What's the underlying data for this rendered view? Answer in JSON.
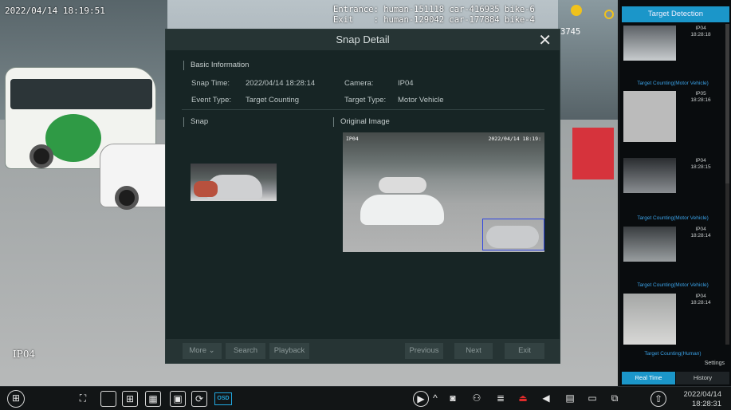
{
  "camera_view": {
    "timestamp": "2022/04/14 18:19:51",
    "counting_line1": "Entrance: human-151118 car-416935 bike-6",
    "counting_line2": "Exit    : human-129042 car-177884 bike-4",
    "counting_extra": "3745",
    "camera_name": "IP04"
  },
  "dialog": {
    "title": "Snap Detail",
    "close_glyph": "✕",
    "basic_info_heading": "Basic Information",
    "snap_time_label": "Snap Time:",
    "snap_time_value": "2022/04/14 18:28:14",
    "camera_label": "Camera:",
    "camera_value": "IP04",
    "event_type_label": "Event Type:",
    "event_type_value": "Target Counting",
    "target_type_label": "Target Type:",
    "target_type_value": "Motor Vehicle",
    "snap_heading": "Snap",
    "original_heading": "Original Image",
    "original_overlay_camera": "IP04",
    "original_overlay_time": "2022/04/14 18:19:",
    "buttons": {
      "more": "More",
      "more_arrow": "⌄",
      "search": "Search",
      "playback": "Playback",
      "previous": "Previous",
      "next": "Next",
      "exit": "Exit"
    }
  },
  "right_panel": {
    "title": "Target Detection",
    "cards": [
      {
        "camera": "IP04",
        "time": "18:28:18",
        "caption": "Target Counting(Motor Vehicle)"
      },
      {
        "camera": "IP05",
        "time": "18:28:16",
        "caption": ""
      },
      {
        "camera": "IP04",
        "time": "18:28:15",
        "caption": "Target Counting(Motor Vehicle)"
      },
      {
        "camera": "IP04",
        "time": "18:28:14",
        "caption": "Target Counting(Motor Vehicle)"
      },
      {
        "camera": "IP04",
        "time": "18:28:14",
        "caption": "Target Counting(Human)"
      }
    ],
    "settings": "Settings",
    "tab_realtime": "Real Time",
    "tab_history": "History"
  },
  "toolbar": {
    "osd_label": "OSD",
    "date": "2022/04/14",
    "time": "18:28:31"
  },
  "colors": {
    "accent": "#1b96c9",
    "caption_blue": "#3aa1e6",
    "dialog_bg": "#172525",
    "bbox_blue": "#2f45e0"
  }
}
